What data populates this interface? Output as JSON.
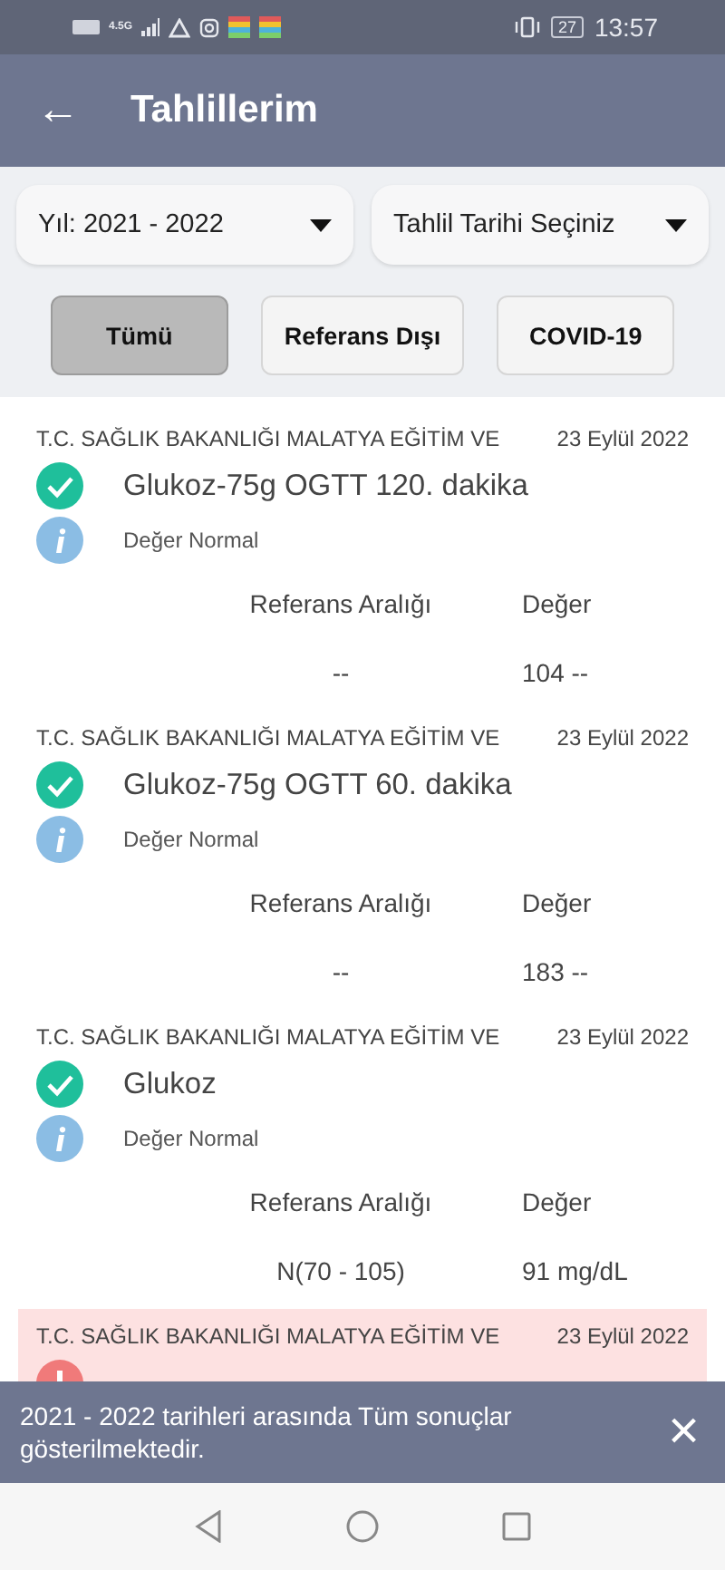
{
  "status_bar": {
    "network": "4.5G",
    "battery": "27",
    "time": "13:57"
  },
  "header": {
    "back_icon": "←",
    "title": "Tahlillerim"
  },
  "filters": [
    {
      "label": "Yıl: 2021 - 2022"
    },
    {
      "label": "Tahlil Tarihi Seçiniz"
    }
  ],
  "tabs": [
    {
      "label": "Tümü",
      "selected": true
    },
    {
      "label": "Referans Dışı",
      "selected": false
    },
    {
      "label": "COVID-19",
      "selected": false
    }
  ],
  "results": [
    {
      "institution": "T.C. SAĞLIK BAKANLIĞI MALATYA EĞİTİM VE",
      "date": "23 Eylül 2022",
      "kind": "normal",
      "test": "Glukoz-75g OGTT 120. dakika",
      "note": "Değer Normal",
      "range_label": "Referans Aralığı",
      "value_label": "Değer",
      "range": "--",
      "value": "104 --"
    },
    {
      "institution": "T.C. SAĞLIK BAKANLIĞI MALATYA EĞİTİM VE",
      "date": "23 Eylül 2022",
      "kind": "normal",
      "test": "Glukoz-75g OGTT 60. dakika",
      "note": "Değer Normal",
      "range_label": "Referans Aralığı",
      "value_label": "Değer",
      "range": "--",
      "value": "183 --"
    },
    {
      "institution": "T.C. SAĞLIK BAKANLIĞI MALATYA EĞİTİM VE",
      "date": "23 Eylül 2022",
      "kind": "normal",
      "test": "Glukoz",
      "note": "Değer Normal",
      "range_label": "Referans Aralığı",
      "value_label": "Değer",
      "range": "N(70 - 105)",
      "value": "91 mg/dL"
    },
    {
      "institution": "T.C. SAĞLIK BAKANLIĞI MALATYA EĞİTİM VE",
      "date": "23 Eylül 2022",
      "kind": "abnormal"
    }
  ],
  "snackbar": {
    "message": "2021 - 2022 tarihleri arasında Tüm sonuçlar gösterilmektedir.",
    "close": "×"
  }
}
